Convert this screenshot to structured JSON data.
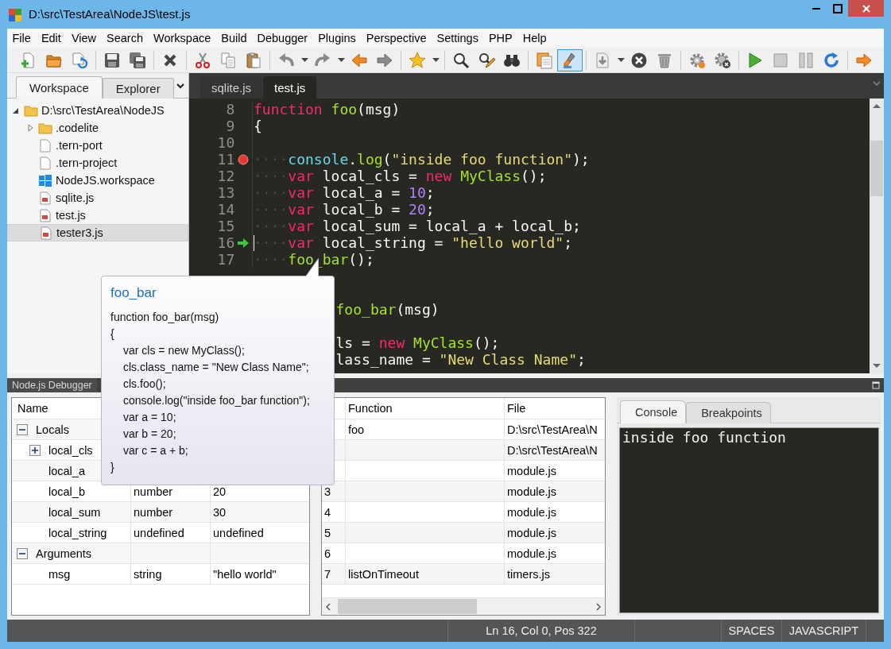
{
  "window": {
    "title": "D:\\src\\TestArea\\NodeJS\\test.js"
  },
  "menu": [
    "File",
    "Edit",
    "View",
    "Search",
    "Workspace",
    "Build",
    "Debugger",
    "Plugins",
    "Perspective",
    "Settings",
    "PHP",
    "Help"
  ],
  "toolbar": [
    {
      "kind": "new-file",
      "pressed": false
    },
    {
      "kind": "open",
      "pressed": false
    },
    {
      "kind": "reload",
      "pressed": false
    },
    {
      "kind": "separator"
    },
    {
      "kind": "save",
      "pressed": false
    },
    {
      "kind": "save-all",
      "pressed": false
    },
    {
      "kind": "separator"
    },
    {
      "kind": "close",
      "pressed": false
    },
    {
      "kind": "separator"
    },
    {
      "kind": "cut",
      "pressed": false
    },
    {
      "kind": "copy",
      "pressed": false
    },
    {
      "kind": "paste",
      "pressed": false
    },
    {
      "kind": "separator"
    },
    {
      "kind": "undo",
      "pressed": false
    },
    {
      "kind": "menu",
      "pressed": false
    },
    {
      "kind": "redo",
      "pressed": false
    },
    {
      "kind": "menu",
      "pressed": false
    },
    {
      "kind": "back",
      "pressed": false
    },
    {
      "kind": "forward",
      "pressed": false
    },
    {
      "kind": "separator"
    },
    {
      "kind": "bookmark",
      "pressed": false
    },
    {
      "kind": "menu",
      "pressed": false
    },
    {
      "kind": "separator"
    },
    {
      "kind": "find",
      "pressed": false
    },
    {
      "kind": "replace",
      "pressed": false
    },
    {
      "kind": "find-in-files",
      "pressed": false
    },
    {
      "kind": "separator"
    },
    {
      "kind": "pages",
      "pressed": false
    },
    {
      "kind": "highlight",
      "pressed": true
    },
    {
      "kind": "separator"
    },
    {
      "kind": "step-down",
      "pressed": false
    },
    {
      "kind": "menu",
      "pressed": false
    },
    {
      "kind": "stop-debugger",
      "pressed": false
    },
    {
      "kind": "trash",
      "pressed": false
    },
    {
      "kind": "separator"
    },
    {
      "kind": "build",
      "pressed": false
    },
    {
      "kind": "stop-build",
      "pressed": false
    },
    {
      "kind": "separator"
    },
    {
      "kind": "run",
      "pressed": false
    },
    {
      "kind": "stop",
      "pressed": false
    },
    {
      "kind": "pause",
      "pressed": false
    },
    {
      "kind": "restart",
      "pressed": false
    },
    {
      "kind": "separator"
    },
    {
      "kind": "step-over",
      "pressed": false
    }
  ],
  "workspace": {
    "tabs": [
      {
        "label": "Workspace",
        "selected": true
      },
      {
        "label": "Explorer",
        "selected": false
      }
    ],
    "tree": [
      {
        "label": "D:\\src\\TestArea\\NodeJS",
        "kind": "folder",
        "expanded": true,
        "selected": false,
        "children": [
          {
            "label": ".codelite",
            "kind": "folder",
            "expanded": false,
            "selected": false
          },
          {
            "label": ".tern-port",
            "kind": "file",
            "selected": false
          },
          {
            "label": ".tern-project",
            "kind": "file",
            "selected": false
          },
          {
            "label": "NodeJS.workspace",
            "kind": "workspace",
            "selected": false
          },
          {
            "label": "sqlite.js",
            "kind": "script",
            "selected": false
          },
          {
            "label": "test.js",
            "kind": "script",
            "selected": false
          },
          {
            "label": "tester3.js",
            "kind": "script",
            "selected": true
          }
        ]
      }
    ]
  },
  "editor": {
    "tabs": [
      {
        "label": "sqlite.js",
        "selected": false
      },
      {
        "label": "test.js",
        "selected": true
      }
    ],
    "lines": [
      {
        "kind": "code",
        "number": "8",
        "caret": false,
        "breakpoint": false,
        "current_line": false,
        "tokens": [
          {
            "kind": "keyword",
            "text": "function "
          },
          {
            "kind": "function",
            "text": "foo"
          },
          {
            "kind": "plain",
            "text": "(msg)"
          }
        ]
      },
      {
        "kind": "code",
        "number": "9",
        "caret": false,
        "breakpoint": false,
        "current_line": false,
        "tokens": [
          {
            "kind": "plain",
            "text": "{"
          }
        ]
      },
      {
        "kind": "code",
        "number": "10",
        "caret": false,
        "breakpoint": false,
        "current_line": false
      },
      {
        "kind": "code",
        "number": "11",
        "caret": false,
        "breakpoint": true,
        "current_line": false,
        "tokens": [
          {
            "kind": "whitespace",
            "text": "····"
          },
          {
            "kind": "builtin",
            "text": "console"
          },
          {
            "kind": "plain",
            "text": "."
          },
          {
            "kind": "function",
            "text": "log"
          },
          {
            "kind": "plain",
            "text": "("
          },
          {
            "kind": "string",
            "text": "\"inside foo function\""
          },
          {
            "kind": "plain",
            "text": ");"
          }
        ]
      },
      {
        "kind": "code",
        "number": "12",
        "caret": false,
        "breakpoint": false,
        "current_line": false,
        "tokens": [
          {
            "kind": "whitespace",
            "text": "····"
          },
          {
            "kind": "keyword",
            "text": "var"
          },
          {
            "kind": "plain",
            "text": " local_cls = "
          },
          {
            "kind": "keyword",
            "text": "new "
          },
          {
            "kind": "function",
            "text": "MyClass"
          },
          {
            "kind": "plain",
            "text": "();"
          }
        ]
      },
      {
        "kind": "code",
        "number": "13",
        "caret": false,
        "breakpoint": false,
        "current_line": false,
        "tokens": [
          {
            "kind": "whitespace",
            "text": "····"
          },
          {
            "kind": "keyword",
            "text": "var"
          },
          {
            "kind": "plain",
            "text": " local_a = "
          },
          {
            "kind": "number",
            "text": "10"
          },
          {
            "kind": "plain",
            "text": ";"
          }
        ]
      },
      {
        "kind": "code",
        "number": "14",
        "caret": false,
        "breakpoint": false,
        "current_line": false,
        "tokens": [
          {
            "kind": "whitespace",
            "text": "····"
          },
          {
            "kind": "keyword",
            "text": "var"
          },
          {
            "kind": "plain",
            "text": " local_b = "
          },
          {
            "kind": "number",
            "text": "20"
          },
          {
            "kind": "plain",
            "text": ";"
          }
        ]
      },
      {
        "kind": "code",
        "number": "15",
        "caret": false,
        "breakpoint": false,
        "current_line": false,
        "tokens": [
          {
            "kind": "whitespace",
            "text": "····"
          },
          {
            "kind": "keyword",
            "text": "var"
          },
          {
            "kind": "plain",
            "text": " local_sum = local_a + local_b;"
          }
        ]
      },
      {
        "kind": "code",
        "number": "16",
        "caret": true,
        "breakpoint": false,
        "current_line": true,
        "tokens": [
          {
            "kind": "whitespace",
            "text": "····"
          },
          {
            "kind": "keyword",
            "text": "var"
          },
          {
            "kind": "plain",
            "text": " local_string = "
          },
          {
            "kind": "string",
            "text": "\"hello world\""
          },
          {
            "kind": "plain",
            "text": ";"
          }
        ]
      },
      {
        "kind": "code",
        "number": "17",
        "caret": false,
        "breakpoint": false,
        "current_line": false,
        "tokens": [
          {
            "kind": "whitespace",
            "text": "····"
          },
          {
            "kind": "function",
            "text": "foo_bar"
          },
          {
            "kind": "plain",
            "text": "();"
          }
        ]
      },
      {
        "kind": "hidden"
      },
      {
        "kind": "hidden"
      },
      {
        "kind": "covered",
        "tokens": [
          {
            "kind": "function",
            "text": "foo_bar"
          },
          {
            "kind": "plain",
            "text": "(msg)"
          }
        ]
      },
      {
        "kind": "hidden"
      },
      {
        "kind": "covered",
        "tokens": [
          {
            "kind": "plain",
            "text": "ls = "
          },
          {
            "kind": "keyword",
            "text": "new "
          },
          {
            "kind": "function",
            "text": "MyClass"
          },
          {
            "kind": "plain",
            "text": "();"
          }
        ]
      },
      {
        "kind": "covered",
        "tokens": [
          {
            "kind": "plain",
            "text": "lass_name = "
          },
          {
            "kind": "string",
            "text": "\"New Class Name\""
          },
          {
            "kind": "plain",
            "text": ";"
          }
        ]
      }
    ]
  },
  "tooltip": {
    "title": "foo_bar",
    "lines": [
      {
        "text": "function foo_bar(msg)"
      },
      {
        "text": "{",
        "children": [
          {
            "text": "var cls = new MyClass();"
          },
          {
            "text": "cls.class_name = \"New Class Name\";"
          },
          {
            "text": "cls.foo();"
          },
          {
            "text": "console.log(\"inside foo_bar function\");"
          },
          {
            "text": "var a = 10;"
          },
          {
            "text": "var b = 20;"
          },
          {
            "text": "var c = a + b;"
          }
        ]
      },
      {
        "text": "}"
      }
    ]
  },
  "debugger": {
    "title": "Node.js Debugger",
    "locals": {
      "columns": [
        "Name"
      ],
      "rows": [
        {
          "name": "Locals",
          "expanded": true,
          "children": [
            {
              "name": "local_cls",
              "expanded": false
            },
            {
              "name": "local_a"
            },
            {
              "name": "local_b",
              "type": "number",
              "value": "20"
            },
            {
              "name": "local_sum",
              "type": "number",
              "value": "30"
            },
            {
              "name": "local_string",
              "type": "undefined",
              "value": "undefined"
            }
          ]
        },
        {
          "name": "Arguments",
          "expanded": true,
          "children": [
            {
              "name": "msg",
              "type": "string",
              "value": "\"hello world\""
            }
          ]
        }
      ]
    },
    "callstack": {
      "columns": [
        "Function",
        "File"
      ],
      "rows": [
        {
          "function": "foo",
          "file": "D:\\src\\TestArea\\N"
        },
        {
          "file": "D:\\src\\TestArea\\N"
        },
        {
          "file": "module.js"
        },
        {
          "frame": "3",
          "file": "module.js"
        },
        {
          "frame": "4",
          "file": "module.js"
        },
        {
          "frame": "5",
          "file": "module.js"
        },
        {
          "frame": "6",
          "file": "module.js"
        },
        {
          "frame": "7",
          "function": "listOnTimeout",
          "file": "timers.js"
        }
      ]
    },
    "console": {
      "tabs": [
        {
          "label": "Console",
          "selected": true
        },
        {
          "label": "Breakpoints",
          "selected": false
        }
      ],
      "output": "inside foo function"
    }
  },
  "status_bar": {
    "position": "Ln 16, Col 0, Pos 322",
    "indent": "SPACES",
    "language": "JAVASCRIPT"
  }
}
